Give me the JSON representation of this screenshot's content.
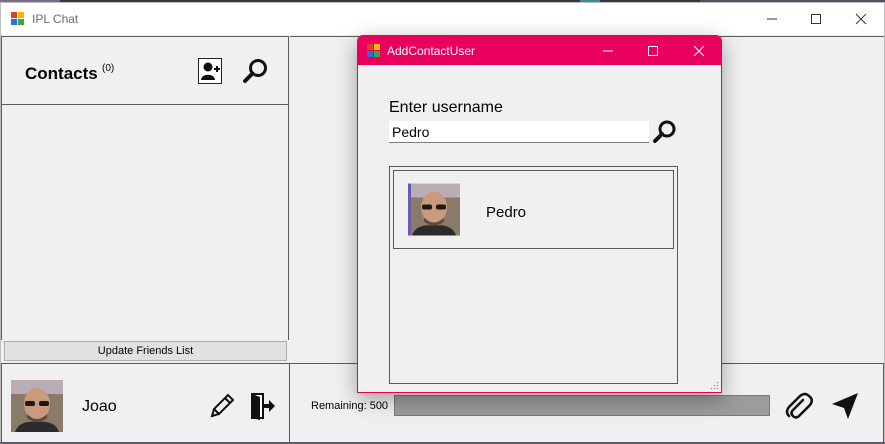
{
  "window": {
    "title": "IPL Chat"
  },
  "contacts": {
    "title": "Contacts",
    "count": "(0)",
    "add_icon": "add-user-icon",
    "search_icon": "search-icon",
    "update_button": "Update Friends List"
  },
  "profile": {
    "name": "Joao",
    "edit_icon": "pencil-icon",
    "logout_icon": "logout-icon"
  },
  "compose": {
    "remaining_label": "Remaining: 500",
    "remaining_fraction": 1.0,
    "attach_icon": "paperclip-icon",
    "send_icon": "send-icon"
  },
  "dialog": {
    "title": "AddContactUser",
    "prompt": "Enter username",
    "input_value": "Pedro",
    "search_icon": "search-icon",
    "results": [
      {
        "name": "Pedro"
      }
    ]
  },
  "colors": {
    "dialog_accent": "#e8005c",
    "window_bg": "#f0f0f0"
  }
}
